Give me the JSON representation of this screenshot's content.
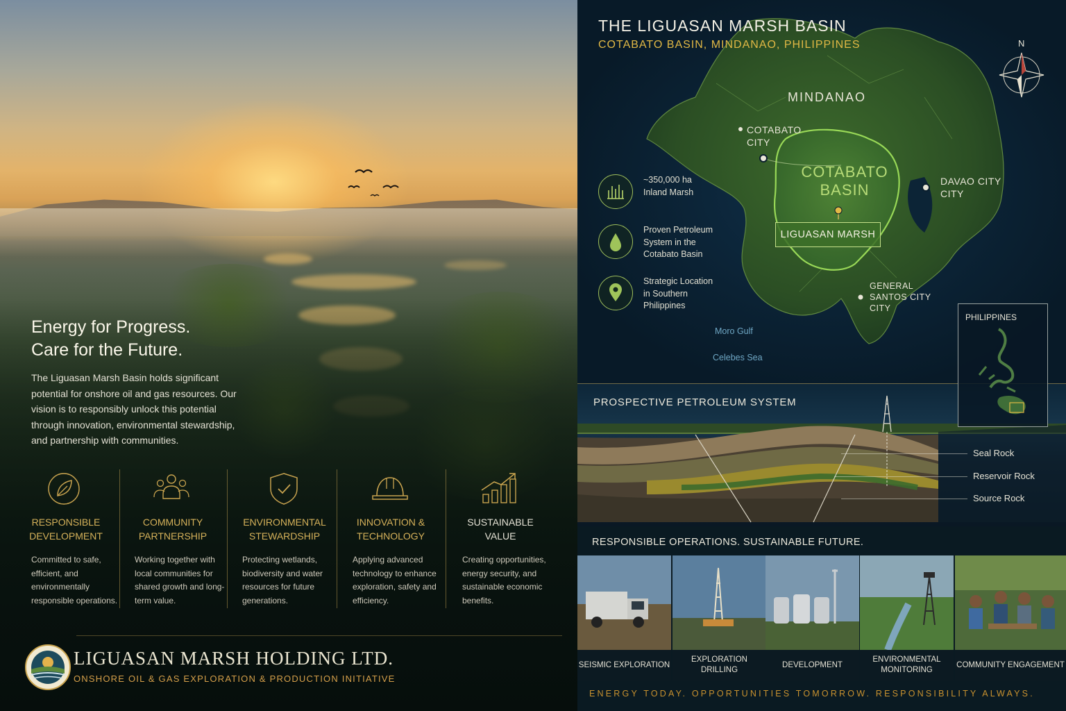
{
  "left": {
    "headline_1": "Energy for Progress.",
    "headline_2": "Care for the Future.",
    "intro": "The Liguasan Marsh Basin holds significant potential for onshore oil and gas resources. Our vision is to responsibly unlock this potential through innovation, environmental stewardship, and partnership with communities.",
    "pillars": [
      {
        "icon": "leaf-icon",
        "title": "RESPONSIBLE DEVELOPMENT",
        "desc": "Committed to safe, efficient, and environmentally responsible operations."
      },
      {
        "icon": "people-icon",
        "title": "COMMUNITY PARTNERSHIP",
        "desc": "Working together with local communities for shared growth and long-term value."
      },
      {
        "icon": "shield-check-icon",
        "title": "ENVIRONMENTAL STEWARDSHIP",
        "desc": "Protecting wetlands, biodiversity and water resources for future generations."
      },
      {
        "icon": "hard-hat-icon",
        "title": "INNOVATION & TECHNOLOGY",
        "desc": "Applying advanced technology to enhance exploration, safety and efficiency."
      },
      {
        "icon": "growth-chart-icon",
        "title": "SUSTAINABLE VALUE",
        "desc": "Creating opportunities, energy security, and sustainable economic benefits."
      }
    ],
    "company_name": "LIGUASAN MARSH HOLDING LTD.",
    "company_sub": "ONSHORE OIL & GAS EXPLORATION & PRODUCTION INITIATIVE"
  },
  "map": {
    "title": "THE LIGUASAN MARSH BASIN",
    "subtitle": "COTABATO BASIN, MINDANAO, PHILIPPINES",
    "compass_n": "N",
    "island_label": "MINDANAO",
    "cities": {
      "cotabato_1": "COTABATO",
      "cotabato_2": "CITY",
      "davao_1": "DAVAO CITY",
      "davao_2": "CITY",
      "gensan_1": "GENERAL",
      "gensan_2": "SANTOS CITY",
      "gensan_3": "CITY"
    },
    "basin_1": "COTABATO",
    "basin_2": "BASIN",
    "marsh_label": "LIGUASAN MARSH",
    "seas": {
      "moro": "Moro Gulf",
      "celebes": "Celebes Sea"
    },
    "inset_title": "PHILIPPINES",
    "features": [
      {
        "icon": "marsh-grass-icon",
        "line1": "~350,000 ha",
        "line2": "Inland Marsh",
        "line3": ""
      },
      {
        "icon": "oil-drop-icon",
        "line1": "Proven Petroleum",
        "line2": "System in the",
        "line3": "Cotabato Basin"
      },
      {
        "icon": "location-pin-icon",
        "line1": "Strategic Location",
        "line2": "in Southern",
        "line3": "Philippines"
      }
    ]
  },
  "petroleum": {
    "title": "PROSPECTIVE PETROLEUM SYSTEM",
    "layers": [
      "Seal Rock",
      "Reservoir Rock",
      "Source Rock"
    ]
  },
  "operations": {
    "title": "RESPONSIBLE OPERATIONS. SUSTAINABLE FUTURE.",
    "cards": [
      "SEISMIC EXPLORATION",
      "EXPLORATION DRILLING",
      "DEVELOPMENT",
      "ENVIRONMENTAL MONITORING",
      "COMMUNITY ENGAGEMENT"
    ]
  },
  "tagline": "ENERGY TODAY. OPPORTUNITIES TOMORROW. RESPONSIBILITY ALWAYS.",
  "colors": {
    "gold": "#d6b25a",
    "amber": "#c9922f",
    "marsh_green": "#b8dc78",
    "navy": "#0a1e2c"
  }
}
